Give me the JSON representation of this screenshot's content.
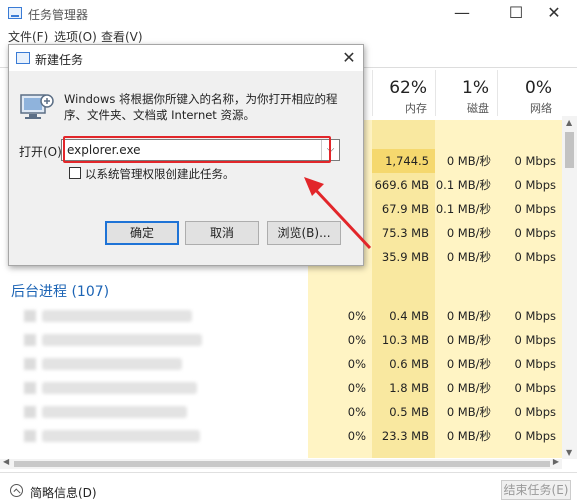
{
  "window": {
    "title": "任务管理器",
    "minimize": "—",
    "maximize": "☐",
    "close": "✕"
  },
  "menu": [
    "文件(F)",
    "选项(O)",
    "查看(V)"
  ],
  "columns": [
    {
      "pct": "62%",
      "label": "内存"
    },
    {
      "pct": "1%",
      "label": "磁盘"
    },
    {
      "pct": "0%",
      "label": "网络"
    }
  ],
  "top_rows": [
    {
      "mem": "1,744.5 ...",
      "disk": "0 MB/秒",
      "net": "0 Mbps"
    },
    {
      "mem": "669.6 MB",
      "disk": "0.1 MB/秒",
      "net": "0 Mbps"
    },
    {
      "mem": "67.9 MB",
      "disk": "0.1 MB/秒",
      "net": "0 Mbps"
    },
    {
      "mem": "75.3 MB",
      "disk": "0 MB/秒",
      "net": "0 Mbps"
    },
    {
      "mem": "35.9 MB",
      "disk": "0 MB/秒",
      "net": "0 Mbps"
    }
  ],
  "background_section": "后台进程 (107)",
  "bg_rows": [
    {
      "cpu": "0%",
      "mem": "0.4 MB",
      "disk": "0 MB/秒",
      "net": "0 Mbps"
    },
    {
      "cpu": "0%",
      "mem": "10.3 MB",
      "disk": "0 MB/秒",
      "net": "0 Mbps"
    },
    {
      "cpu": "0%",
      "mem": "0.6 MB",
      "disk": "0 MB/秒",
      "net": "0 Mbps"
    },
    {
      "cpu": "0%",
      "mem": "1.8 MB",
      "disk": "0 MB/秒",
      "net": "0 Mbps"
    },
    {
      "cpu": "0%",
      "mem": "0.5 MB",
      "disk": "0 MB/秒",
      "net": "0 Mbps"
    },
    {
      "cpu": "0%",
      "mem": "23.3 MB",
      "disk": "0 MB/秒",
      "net": "0 Mbps"
    }
  ],
  "footer": {
    "less_details": "简略信息(D)",
    "end_task": "结束任务(E)"
  },
  "dialog": {
    "title": "新建任务",
    "close": "✕",
    "description": "Windows 将根据你所键入的名称，为你打开相应的程序、文件夹、文档或 Internet 资源。",
    "open_label": "打开(O):",
    "input_value": "explorer.exe",
    "admin_checkbox_label": "以系统管理权限创建此任务。",
    "ok": "确定",
    "cancel": "取消",
    "browse": "浏览(B)..."
  },
  "colors": {
    "highlight": "#e2262a",
    "accent": "#1c64b5",
    "mem_column": "#fff4c4",
    "mem_column_dark": "#f9e8a0"
  }
}
